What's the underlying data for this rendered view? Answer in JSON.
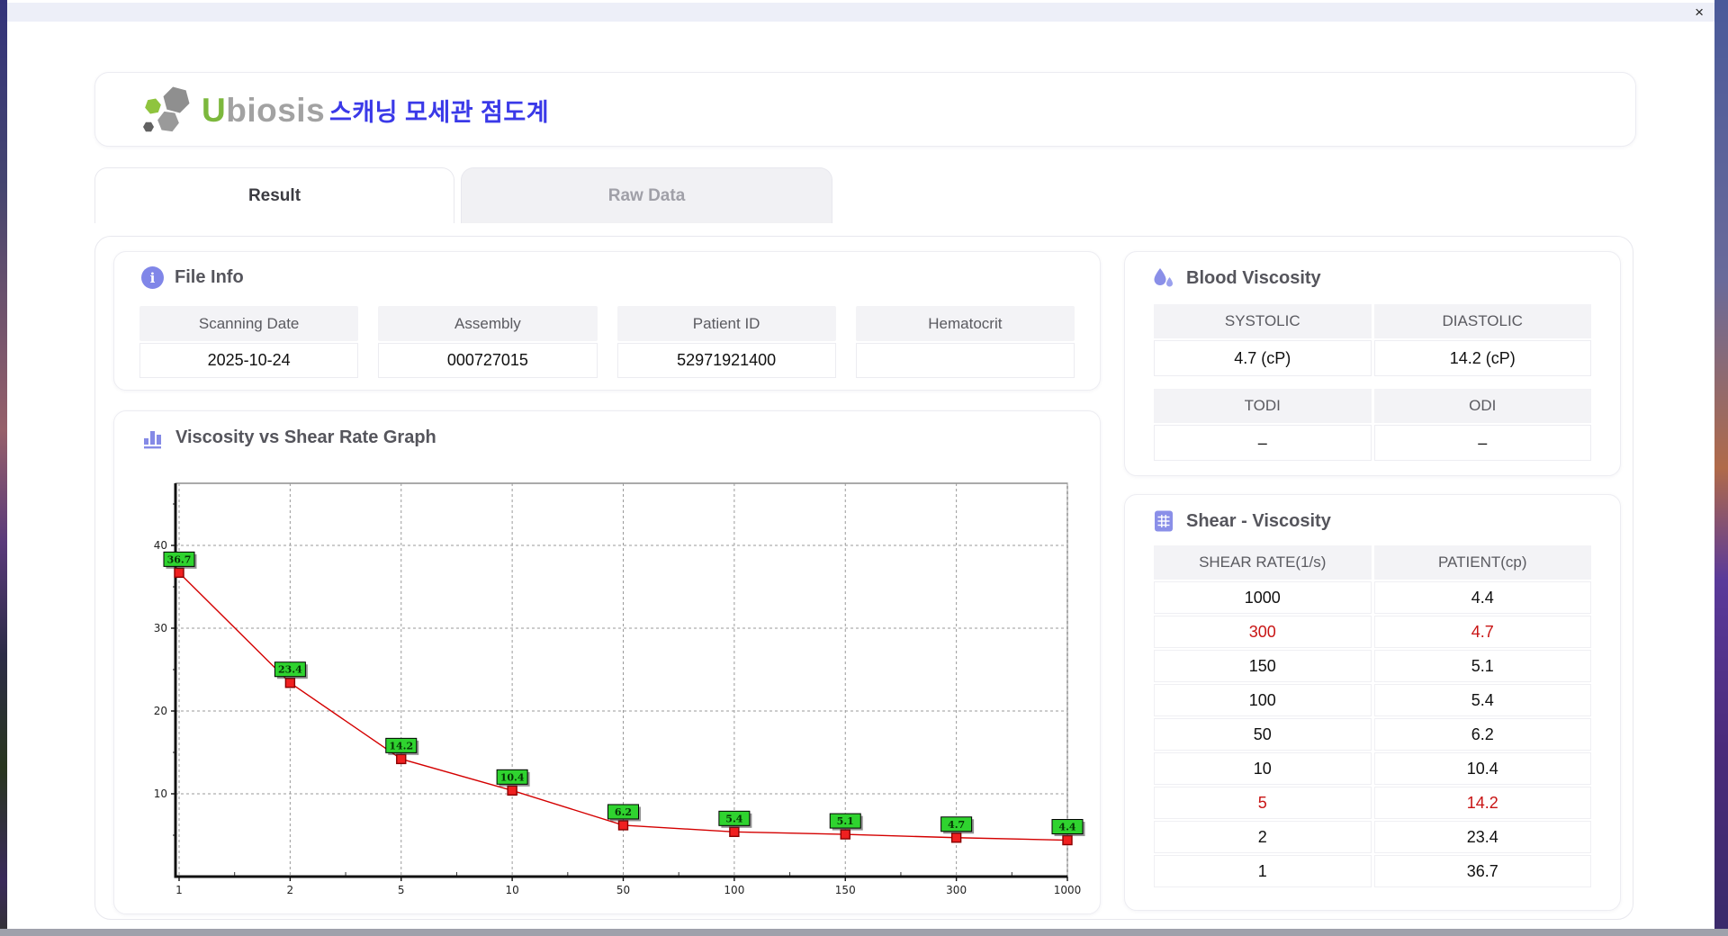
{
  "window": {
    "close_icon": "×"
  },
  "header": {
    "logo_first_letter": "U",
    "logo_rest": "biosis",
    "title_ko": "스캐닝 모세관 점도계"
  },
  "tabs": [
    {
      "label": "Result",
      "active": true
    },
    {
      "label": "Raw Data",
      "active": false
    }
  ],
  "file_info": {
    "title": "File Info",
    "fields": [
      {
        "label": "Scanning Date",
        "value": "2025-10-24"
      },
      {
        "label": "Assembly",
        "value": "000727015"
      },
      {
        "label": "Patient ID",
        "value": "52971921400"
      },
      {
        "label": "Hematocrit",
        "value": ""
      }
    ]
  },
  "blood_viscosity": {
    "title": "Blood Viscosity",
    "pairs": [
      {
        "headers": [
          "SYSTOLIC",
          "DIASTOLIC"
        ],
        "values": [
          "4.7 (cP)",
          "14.2 (cP)"
        ]
      },
      {
        "headers": [
          "TODI",
          "ODI"
        ],
        "values": [
          "–",
          "–"
        ]
      }
    ]
  },
  "shear_viscosity": {
    "title": "Shear - Viscosity",
    "columns": [
      "SHEAR RATE(1/s)",
      "PATIENT(cp)"
    ],
    "rows": [
      {
        "rate": "1000",
        "value": "4.4",
        "highlight": false
      },
      {
        "rate": "300",
        "value": "4.7",
        "highlight": true
      },
      {
        "rate": "150",
        "value": "5.1",
        "highlight": false
      },
      {
        "rate": "100",
        "value": "5.4",
        "highlight": false
      },
      {
        "rate": "50",
        "value": "6.2",
        "highlight": false
      },
      {
        "rate": "10",
        "value": "10.4",
        "highlight": false
      },
      {
        "rate": "5",
        "value": "14.2",
        "highlight": true
      },
      {
        "rate": "2",
        "value": "23.4",
        "highlight": false
      },
      {
        "rate": "1",
        "value": "36.7",
        "highlight": false
      }
    ]
  },
  "chart_data": {
    "type": "line",
    "title": "Viscosity vs Shear Rate Graph",
    "x": [
      1,
      2,
      5,
      10,
      50,
      100,
      150,
      300,
      1000
    ],
    "y": [
      36.7,
      23.4,
      14.2,
      10.4,
      6.2,
      5.4,
      5.1,
      4.7,
      4.4
    ],
    "xlabel": "",
    "ylabel": "",
    "x_scale": "categorical",
    "yticks": [
      10,
      20,
      30,
      40
    ],
    "ylim": [
      0,
      47.5
    ],
    "grid": true,
    "legend": "none",
    "line_color": "#d40000",
    "marker_color": "#f02020",
    "marker_border": "#8a0000",
    "label_bg": "#2fd32f",
    "label_border": "#000000",
    "label_text_color": "#053305"
  },
  "colors": {
    "accent_purple": "#8086e8",
    "title_blue": "#3a39e8",
    "logo_green": "#7cb83d",
    "highlight_red": "#c81414",
    "header_bg": "#f3f3f6"
  }
}
